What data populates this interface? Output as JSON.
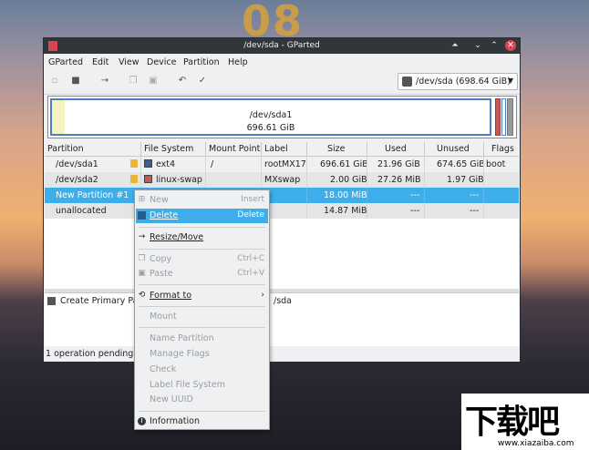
{
  "desktop": {
    "clock": "08",
    "watermark_big": "下载吧",
    "watermark_url": "www.xiazaiba.com"
  },
  "window": {
    "title": "/dev/sda - GParted",
    "menu": [
      "GParted",
      "Edit",
      "View",
      "Device",
      "Partition",
      "Help"
    ],
    "device": "/dev/sda  (698.64 GiB)",
    "diskmap": {
      "name": "/dev/sda1",
      "size": "696.61 GiB"
    },
    "columns": [
      "Partition",
      "File System",
      "Mount Point",
      "Label",
      "Size",
      "Used",
      "Unused",
      "Flags"
    ],
    "rows": [
      {
        "partition": "/dev/sda1",
        "fs": "ext4",
        "fs_color": "#3f5f8f",
        "mount": "/",
        "label": "rootMX17",
        "size": "696.61 GiB",
        "used": "21.96 GiB",
        "unused": "674.65 GiB",
        "flags": "boot"
      },
      {
        "partition": "/dev/sda2",
        "fs": "linux-swap",
        "fs_color": "#c45a52",
        "mount": "",
        "label": "MXswap",
        "size": "2.00 GiB",
        "used": "27.26 MiB",
        "unused": "1.97 GiB",
        "flags": ""
      },
      {
        "partition": "New Partition #1",
        "fs": "",
        "mount": "",
        "label": "",
        "size": "18.00 MiB",
        "used": "---",
        "unused": "---",
        "flags": ""
      },
      {
        "partition": "unallocated",
        "fs": "",
        "mount": "",
        "label": "",
        "size": "14.87 MiB",
        "used": "---",
        "unused": "---",
        "flags": ""
      }
    ],
    "operation_text_left": "Create Primary Par",
    "operation_text_right": "/sda",
    "status": "1 operation pending"
  },
  "context_menu": {
    "new": {
      "label": "New",
      "shortcut": "Insert"
    },
    "delete": {
      "label": "Delete",
      "shortcut": "Delete"
    },
    "resize": {
      "label": "Resize/Move"
    },
    "copy": {
      "label": "Copy",
      "shortcut": "Ctrl+C"
    },
    "paste": {
      "label": "Paste",
      "shortcut": "Ctrl+V"
    },
    "format": {
      "label": "Format to"
    },
    "mount": {
      "label": "Mount"
    },
    "name_partition": {
      "label": "Name Partition"
    },
    "manage_flags": {
      "label": "Manage Flags"
    },
    "check": {
      "label": "Check"
    },
    "label_fs": {
      "label": "Label File System"
    },
    "new_uuid": {
      "label": "New UUID"
    },
    "information": {
      "label": "Information"
    }
  }
}
